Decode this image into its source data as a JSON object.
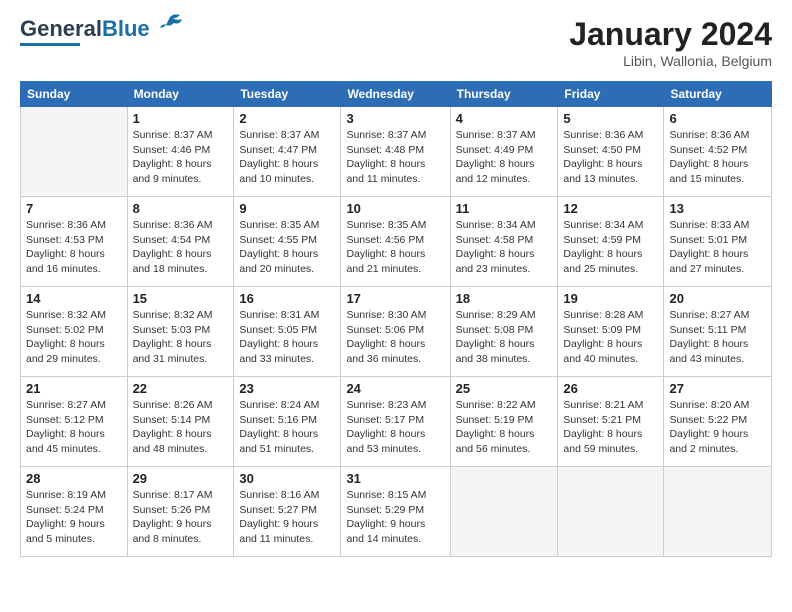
{
  "header": {
    "logo_general": "General",
    "logo_blue": "Blue",
    "month_title": "January 2024",
    "location": "Libin, Wallonia, Belgium"
  },
  "days_of_week": [
    "Sunday",
    "Monday",
    "Tuesday",
    "Wednesday",
    "Thursday",
    "Friday",
    "Saturday"
  ],
  "weeks": [
    [
      {
        "day": "",
        "sunrise": "",
        "sunset": "",
        "daylight": "",
        "empty": true
      },
      {
        "day": "1",
        "sunrise": "Sunrise: 8:37 AM",
        "sunset": "Sunset: 4:46 PM",
        "daylight": "Daylight: 8 hours and 9 minutes.",
        "empty": false
      },
      {
        "day": "2",
        "sunrise": "Sunrise: 8:37 AM",
        "sunset": "Sunset: 4:47 PM",
        "daylight": "Daylight: 8 hours and 10 minutes.",
        "empty": false
      },
      {
        "day": "3",
        "sunrise": "Sunrise: 8:37 AM",
        "sunset": "Sunset: 4:48 PM",
        "daylight": "Daylight: 8 hours and 11 minutes.",
        "empty": false
      },
      {
        "day": "4",
        "sunrise": "Sunrise: 8:37 AM",
        "sunset": "Sunset: 4:49 PM",
        "daylight": "Daylight: 8 hours and 12 minutes.",
        "empty": false
      },
      {
        "day": "5",
        "sunrise": "Sunrise: 8:36 AM",
        "sunset": "Sunset: 4:50 PM",
        "daylight": "Daylight: 8 hours and 13 minutes.",
        "empty": false
      },
      {
        "day": "6",
        "sunrise": "Sunrise: 8:36 AM",
        "sunset": "Sunset: 4:52 PM",
        "daylight": "Daylight: 8 hours and 15 minutes.",
        "empty": false
      }
    ],
    [
      {
        "day": "7",
        "sunrise": "Sunrise: 8:36 AM",
        "sunset": "Sunset: 4:53 PM",
        "daylight": "Daylight: 8 hours and 16 minutes.",
        "empty": false
      },
      {
        "day": "8",
        "sunrise": "Sunrise: 8:36 AM",
        "sunset": "Sunset: 4:54 PM",
        "daylight": "Daylight: 8 hours and 18 minutes.",
        "empty": false
      },
      {
        "day": "9",
        "sunrise": "Sunrise: 8:35 AM",
        "sunset": "Sunset: 4:55 PM",
        "daylight": "Daylight: 8 hours and 20 minutes.",
        "empty": false
      },
      {
        "day": "10",
        "sunrise": "Sunrise: 8:35 AM",
        "sunset": "Sunset: 4:56 PM",
        "daylight": "Daylight: 8 hours and 21 minutes.",
        "empty": false
      },
      {
        "day": "11",
        "sunrise": "Sunrise: 8:34 AM",
        "sunset": "Sunset: 4:58 PM",
        "daylight": "Daylight: 8 hours and 23 minutes.",
        "empty": false
      },
      {
        "day": "12",
        "sunrise": "Sunrise: 8:34 AM",
        "sunset": "Sunset: 4:59 PM",
        "daylight": "Daylight: 8 hours and 25 minutes.",
        "empty": false
      },
      {
        "day": "13",
        "sunrise": "Sunrise: 8:33 AM",
        "sunset": "Sunset: 5:01 PM",
        "daylight": "Daylight: 8 hours and 27 minutes.",
        "empty": false
      }
    ],
    [
      {
        "day": "14",
        "sunrise": "Sunrise: 8:32 AM",
        "sunset": "Sunset: 5:02 PM",
        "daylight": "Daylight: 8 hours and 29 minutes.",
        "empty": false
      },
      {
        "day": "15",
        "sunrise": "Sunrise: 8:32 AM",
        "sunset": "Sunset: 5:03 PM",
        "daylight": "Daylight: 8 hours and 31 minutes.",
        "empty": false
      },
      {
        "day": "16",
        "sunrise": "Sunrise: 8:31 AM",
        "sunset": "Sunset: 5:05 PM",
        "daylight": "Daylight: 8 hours and 33 minutes.",
        "empty": false
      },
      {
        "day": "17",
        "sunrise": "Sunrise: 8:30 AM",
        "sunset": "Sunset: 5:06 PM",
        "daylight": "Daylight: 8 hours and 36 minutes.",
        "empty": false
      },
      {
        "day": "18",
        "sunrise": "Sunrise: 8:29 AM",
        "sunset": "Sunset: 5:08 PM",
        "daylight": "Daylight: 8 hours and 38 minutes.",
        "empty": false
      },
      {
        "day": "19",
        "sunrise": "Sunrise: 8:28 AM",
        "sunset": "Sunset: 5:09 PM",
        "daylight": "Daylight: 8 hours and 40 minutes.",
        "empty": false
      },
      {
        "day": "20",
        "sunrise": "Sunrise: 8:27 AM",
        "sunset": "Sunset: 5:11 PM",
        "daylight": "Daylight: 8 hours and 43 minutes.",
        "empty": false
      }
    ],
    [
      {
        "day": "21",
        "sunrise": "Sunrise: 8:27 AM",
        "sunset": "Sunset: 5:12 PM",
        "daylight": "Daylight: 8 hours and 45 minutes.",
        "empty": false
      },
      {
        "day": "22",
        "sunrise": "Sunrise: 8:26 AM",
        "sunset": "Sunset: 5:14 PM",
        "daylight": "Daylight: 8 hours and 48 minutes.",
        "empty": false
      },
      {
        "day": "23",
        "sunrise": "Sunrise: 8:24 AM",
        "sunset": "Sunset: 5:16 PM",
        "daylight": "Daylight: 8 hours and 51 minutes.",
        "empty": false
      },
      {
        "day": "24",
        "sunrise": "Sunrise: 8:23 AM",
        "sunset": "Sunset: 5:17 PM",
        "daylight": "Daylight: 8 hours and 53 minutes.",
        "empty": false
      },
      {
        "day": "25",
        "sunrise": "Sunrise: 8:22 AM",
        "sunset": "Sunset: 5:19 PM",
        "daylight": "Daylight: 8 hours and 56 minutes.",
        "empty": false
      },
      {
        "day": "26",
        "sunrise": "Sunrise: 8:21 AM",
        "sunset": "Sunset: 5:21 PM",
        "daylight": "Daylight: 8 hours and 59 minutes.",
        "empty": false
      },
      {
        "day": "27",
        "sunrise": "Sunrise: 8:20 AM",
        "sunset": "Sunset: 5:22 PM",
        "daylight": "Daylight: 9 hours and 2 minutes.",
        "empty": false
      }
    ],
    [
      {
        "day": "28",
        "sunrise": "Sunrise: 8:19 AM",
        "sunset": "Sunset: 5:24 PM",
        "daylight": "Daylight: 9 hours and 5 minutes.",
        "empty": false
      },
      {
        "day": "29",
        "sunrise": "Sunrise: 8:17 AM",
        "sunset": "Sunset: 5:26 PM",
        "daylight": "Daylight: 9 hours and 8 minutes.",
        "empty": false
      },
      {
        "day": "30",
        "sunrise": "Sunrise: 8:16 AM",
        "sunset": "Sunset: 5:27 PM",
        "daylight": "Daylight: 9 hours and 11 minutes.",
        "empty": false
      },
      {
        "day": "31",
        "sunrise": "Sunrise: 8:15 AM",
        "sunset": "Sunset: 5:29 PM",
        "daylight": "Daylight: 9 hours and 14 minutes.",
        "empty": false
      },
      {
        "day": "",
        "sunrise": "",
        "sunset": "",
        "daylight": "",
        "empty": true
      },
      {
        "day": "",
        "sunrise": "",
        "sunset": "",
        "daylight": "",
        "empty": true
      },
      {
        "day": "",
        "sunrise": "",
        "sunset": "",
        "daylight": "",
        "empty": true
      }
    ]
  ]
}
